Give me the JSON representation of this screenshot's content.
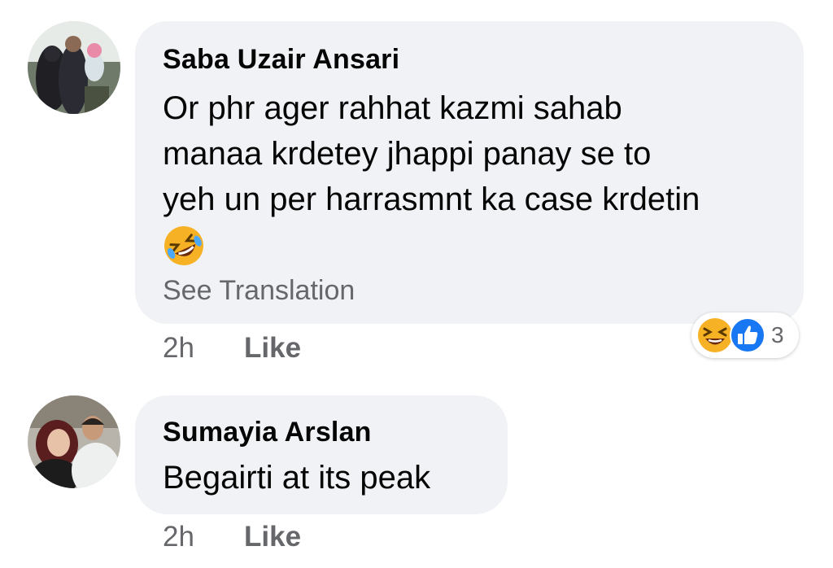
{
  "comments": [
    {
      "author": "Saba Uzair Ansari",
      "text_lines": [
        "Or phr ager rahhat kazmi sahab",
        "manaa krdetey jhappi panay se to",
        "yeh un per harrasmnt ka case krdetin"
      ],
      "emoji_icon": "rolling-on-floor-laughing-icon",
      "see_translation": "See Translation",
      "time": "2h",
      "like_label": "Like",
      "reactions": {
        "icons": [
          "laughing-reaction-icon",
          "like-reaction-icon"
        ],
        "count": "3"
      }
    },
    {
      "author": "Sumayia Arslan",
      "text_lines": [
        "Begairti at its peak"
      ],
      "time": "2h",
      "like_label": "Like"
    }
  ],
  "colors": {
    "bubble_bg": "#f0f2f5",
    "secondary_text": "#65676b",
    "primary_text": "#050505",
    "like_blue": "#1877f2",
    "emoji_yellow": "#f7b125"
  }
}
